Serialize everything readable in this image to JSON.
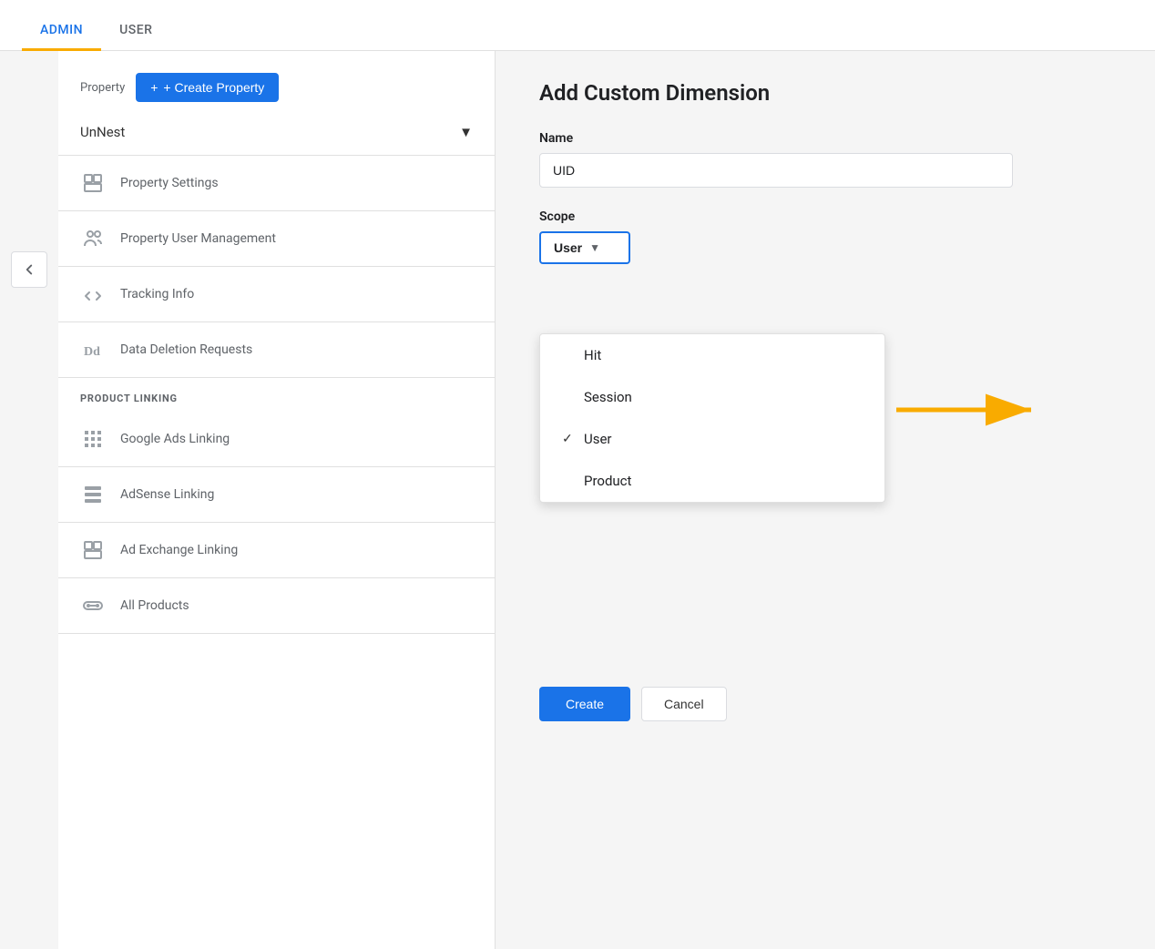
{
  "nav": {
    "items": [
      {
        "label": "ADMIN",
        "active": true
      },
      {
        "label": "USER",
        "active": false
      }
    ]
  },
  "sidebar": {
    "property_label": "Property",
    "create_property_label": "+ Create Property",
    "selected_property": "UnNest",
    "menu_items": [
      {
        "id": "property-settings",
        "label": "Property Settings",
        "icon": "layout"
      },
      {
        "id": "property-user-management",
        "label": "Property User Management",
        "icon": "users"
      },
      {
        "id": "tracking-info",
        "label": "Tracking Info",
        "icon": "code"
      },
      {
        "id": "data-deletion-requests",
        "label": "Data Deletion Requests",
        "icon": "text-dd"
      }
    ],
    "product_linking_header": "PRODUCT LINKING",
    "product_linking_items": [
      {
        "id": "google-ads-linking",
        "label": "Google Ads Linking",
        "icon": "grid"
      },
      {
        "id": "adsense-linking",
        "label": "AdSense Linking",
        "icon": "grid2"
      },
      {
        "id": "ad-exchange-linking",
        "label": "Ad Exchange Linking",
        "icon": "layout2"
      },
      {
        "id": "all-products",
        "label": "All Products",
        "icon": "chain"
      }
    ]
  },
  "form": {
    "title": "Add Custom Dimension",
    "name_label": "Name",
    "name_value": "UID",
    "name_placeholder": "",
    "scope_label": "Scope",
    "scope_selected": "User",
    "scope_options": [
      {
        "value": "Hit",
        "selected": false
      },
      {
        "value": "Session",
        "selected": false
      },
      {
        "value": "User",
        "selected": true
      },
      {
        "value": "Product",
        "selected": false
      }
    ],
    "create_label": "Create",
    "cancel_label": "Cancel"
  }
}
